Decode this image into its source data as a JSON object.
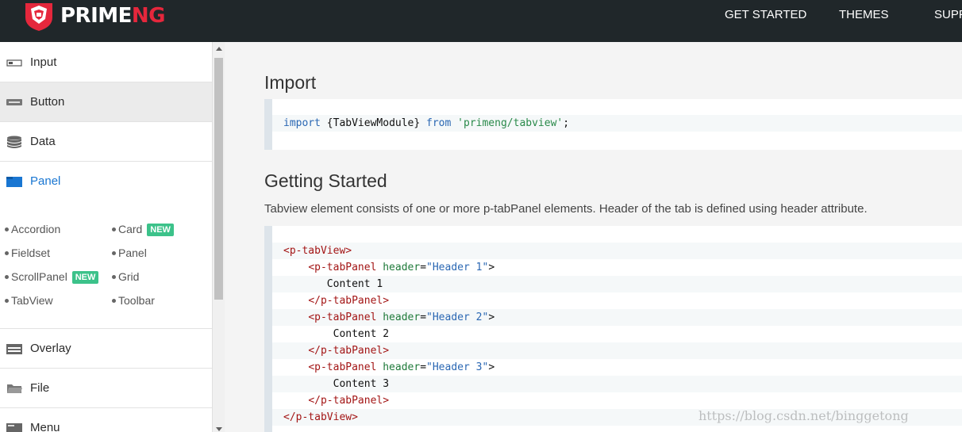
{
  "brand": {
    "name_primary": "PRIME",
    "name_accent": "NG",
    "colors": {
      "accent": "#e5273c",
      "topbar": "#20272a",
      "link": "#1976d2",
      "badge": "#3cc28a"
    }
  },
  "topnav": [
    "GET STARTED",
    "THEMES",
    "SUPP"
  ],
  "sidebar": {
    "items": [
      {
        "label": "Input",
        "icon": "input-icon"
      },
      {
        "label": "Button",
        "icon": "button-icon"
      },
      {
        "label": "Data",
        "icon": "database-icon"
      },
      {
        "label": "Panel",
        "icon": "panel-icon"
      },
      {
        "label": "Overlay",
        "icon": "overlay-icon"
      },
      {
        "label": "File",
        "icon": "folder-icon"
      },
      {
        "label": "Menu",
        "icon": "menu-icon"
      }
    ],
    "panel_sub": [
      {
        "label": "Accordion"
      },
      {
        "label": "Card",
        "badge": "NEW"
      },
      {
        "label": "Fieldset"
      },
      {
        "label": "Panel"
      },
      {
        "label": "ScrollPanel",
        "badge": "NEW"
      },
      {
        "label": "Grid"
      },
      {
        "label": "TabView"
      },
      {
        "label": "Toolbar"
      }
    ]
  },
  "main": {
    "import_heading": "Import",
    "import_code": {
      "keyword": "import",
      "name": "{TabViewModule}",
      "from": "from",
      "path": "'primeng/tabview'",
      "end": ";"
    },
    "getting_started_heading": "Getting Started",
    "description": "Tabview element consists of one or more p-tabPanel elements. Header of the tab is defined using header attribute.",
    "code": {
      "open_view": "<p-tabView>",
      "close_view": "</p-tabView>",
      "panels": [
        {
          "open": "<p-tabPanel",
          "attr": "header",
          "eq": "=",
          "value": "\"Header 1\"",
          "gt": ">",
          "content": "Content 1",
          "close": "</p-tabPanel>"
        },
        {
          "open": "<p-tabPanel",
          "attr": "header",
          "eq": "=",
          "value": "\"Header 2\"",
          "gt": ">",
          "content": "Content 2",
          "close": "</p-tabPanel>"
        },
        {
          "open": "<p-tabPanel",
          "attr": "header",
          "eq": "=",
          "value": "\"Header 3\"",
          "gt": ">",
          "content": "Content 3",
          "close": "</p-tabPanel>"
        }
      ]
    }
  },
  "watermark": "https://blog.csdn.net/binggetong"
}
